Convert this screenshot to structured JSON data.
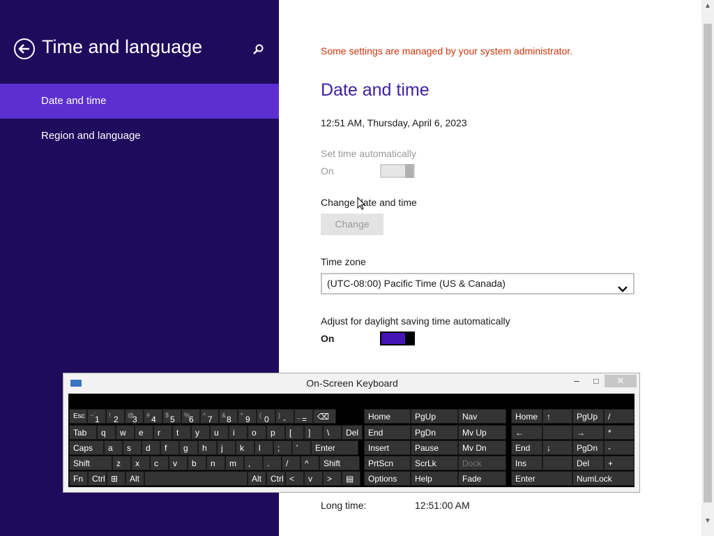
{
  "sidebar": {
    "title": "Time and language",
    "items": [
      {
        "label": "Date and time",
        "active": true
      },
      {
        "label": "Region and language",
        "active": false
      }
    ]
  },
  "main": {
    "admin_note": "Some settings are managed by your system administrator.",
    "section_title": "Date and time",
    "current_datetime": "12:51 AM, Thursday, April 6, 2023",
    "set_time_auto_label": "Set time automatically",
    "set_time_auto_state": "On",
    "change_label": "Change date and time",
    "change_button": "Change",
    "timezone_label": "Time zone",
    "timezone_value": "(UTC-08:00) Pacific Time (US & Canada)",
    "dst_label": "Adjust for daylight saving time automatically",
    "dst_state": "On",
    "long_time_label": "Long time:",
    "long_time_value": "12:51:00 AM"
  },
  "osk": {
    "title": "On-Screen Keyboard",
    "close": "✕",
    "row1": [
      "Esc",
      "1",
      "2",
      "3",
      "4",
      "5",
      "6",
      "7",
      "8",
      "9",
      "0",
      "-",
      "="
    ],
    "row1_shift": [
      "",
      "~`",
      "!",
      "@",
      "#",
      "$",
      "%",
      "^",
      "&",
      "*",
      "(",
      ")",
      "_",
      "+"
    ],
    "row2": [
      "Tab",
      "q",
      "w",
      "e",
      "r",
      "t",
      "y",
      "u",
      "i",
      "o",
      "p",
      "[",
      "]",
      "\\",
      "Del"
    ],
    "row3": [
      "Caps",
      "a",
      "s",
      "d",
      "f",
      "g",
      "h",
      "j",
      "k",
      "l",
      ";",
      "'",
      "Enter"
    ],
    "row4": [
      "Shift",
      "z",
      "x",
      "c",
      "v",
      "b",
      "n",
      "m",
      ",",
      ".",
      "/",
      "^",
      "Shift"
    ],
    "row5": [
      "Fn",
      "Ctrl",
      "Alt",
      "Alt",
      "Ctrl",
      "<",
      "v",
      ">"
    ],
    "nav_keys": [
      "Home",
      "PgUp",
      "Nav",
      "End",
      "PgDn",
      "Mv Up",
      "Insert",
      "Pause",
      "Mv Dn",
      "PrtScn",
      "ScrLk",
      "Dock",
      "Options",
      "Help",
      "Fade"
    ],
    "numpad": [
      "Home",
      "↑",
      "PgUp",
      "/",
      "←",
      "",
      "→",
      "*",
      "End",
      "↓",
      "PgDn",
      "-",
      "Ins",
      "",
      "Del",
      "+",
      "Enter",
      "NumLock"
    ]
  }
}
